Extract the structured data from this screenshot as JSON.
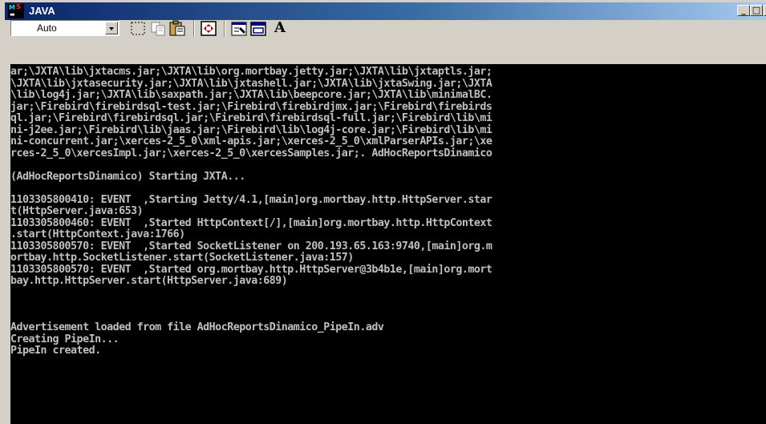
{
  "window": {
    "title": "JAVA",
    "icon": "ms-dos-icon",
    "icon_text": "MS"
  },
  "titlebar_buttons": {
    "minimize_glyph": "_",
    "maximize_glyph": "□",
    "close_glyph": "×"
  },
  "toolbar": {
    "font_size_value": "Auto",
    "tools": [
      "mark-icon",
      "copy-icon",
      "paste-icon",
      "fullscreen-icon",
      "properties-icon",
      "background-icon",
      "font-icon"
    ],
    "font_button_label": "A"
  },
  "console": {
    "lines": [
      "ar;\\JXTA\\lib\\jxtacms.jar;\\JXTA\\lib\\org.mortbay.jetty.jar;\\JXTA\\lib\\jxtaptls.jar;",
      "\\JXTA\\lib\\jxtasecurity.jar;\\JXTA\\lib\\jxtashell.jar;\\JXTA\\lib\\jxtaSwing.jar;\\JXTA",
      "\\lib\\log4j.jar;\\JXTA\\lib\\saxpath.jar;\\JXTA\\lib\\beepcore.jar;\\JXTA\\lib\\minimalBC.",
      "jar;\\Firebird\\firebirdsql-test.jar;\\Firebird\\firebirdjmx.jar;\\Firebird\\firebirds",
      "ql.jar;\\Firebird\\firebirdsql.jar;\\Firebird\\firebirdsql-full.jar;\\Firebird\\lib\\mi",
      "ni-j2ee.jar;\\Firebird\\lib\\jaas.jar;\\Firebird\\lib\\log4j-core.jar;\\Firebird\\lib\\mi",
      "ni-concurrent.jar;\\xerces-2_5_0\\xml-apis.jar;\\xerces-2_5_0\\xmlParserAPIs.jar;\\xe",
      "rces-2_5_0\\xercesImpl.jar;\\xerces-2_5_0\\xercesSamples.jar;. AdHocReportsDinamico",
      "",
      "(AdHocReportsDinamico) Starting JXTA...",
      "",
      "1103305800410: EVENT  ,Starting Jetty/4.1,[main]org.mortbay.http.HttpServer.star",
      "t(HttpServer.java:653)",
      "1103305800460: EVENT  ,Started HttpContext[/],[main]org.mortbay.http.HttpContext",
      ".start(HttpContext.java:1766)",
      "1103305800570: EVENT  ,Started SocketListener on 200.193.65.163:9740,[main]org.m",
      "ortbay.http.SocketListener.start(SocketListener.java:157)",
      "1103305800570: EVENT  ,Started org.mortbay.http.HttpServer@3b4b1e,[main]org.mort",
      "bay.http.HttpServer.start(HttpServer.java:689)",
      "",
      "",
      "",
      "Advertisement loaded from file AdHocReportsDinamico_PipeIn.adv",
      "Creating PipeIn...",
      "PipeIn created."
    ]
  }
}
